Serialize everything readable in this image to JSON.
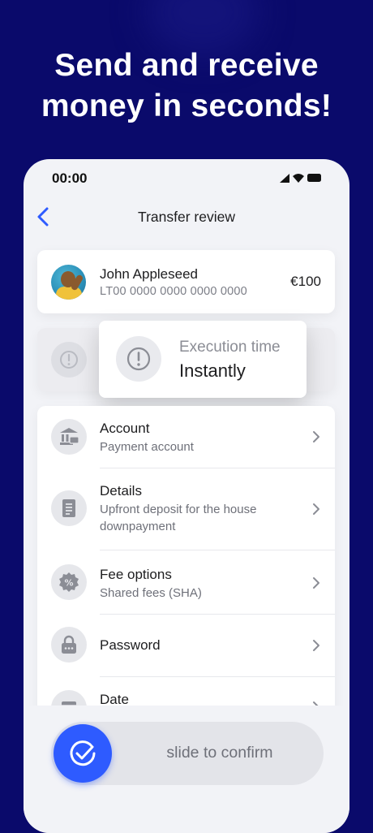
{
  "headline": "Send and receive money in seconds!",
  "status_bar": {
    "time": "00:00",
    "icons": [
      "signal-icon",
      "wifi-icon",
      "battery-icon"
    ]
  },
  "nav": {
    "back_icon": "chevron-left-icon",
    "title": "Transfer review"
  },
  "recipient": {
    "name": "John Appleseed",
    "iban": "LT00 0000 0000 0000 0000",
    "amount": "€100"
  },
  "execution": {
    "icon": "exclamation-circle-icon",
    "label": "Execution time",
    "value": "Instantly"
  },
  "rows": [
    {
      "icon": "bank-icon",
      "title": "Account",
      "subtitle": "Payment account"
    },
    {
      "icon": "document-icon",
      "title": "Details",
      "subtitle": "Upfront deposit for the house downpayment"
    },
    {
      "icon": "percent-badge-icon",
      "title": "Fee options",
      "subtitle": "Shared fees (SHA)"
    },
    {
      "icon": "lock-icon",
      "title": "Password",
      "subtitle": ""
    },
    {
      "icon": "calendar-icon",
      "title": "Date",
      "subtitle": ""
    }
  ],
  "slider": {
    "label": "slide to confirm",
    "icon": "check-circle-icon"
  },
  "colors": {
    "background": "#0a0a6b",
    "accent": "#2e5bff",
    "back_arrow": "#2e5bff"
  }
}
